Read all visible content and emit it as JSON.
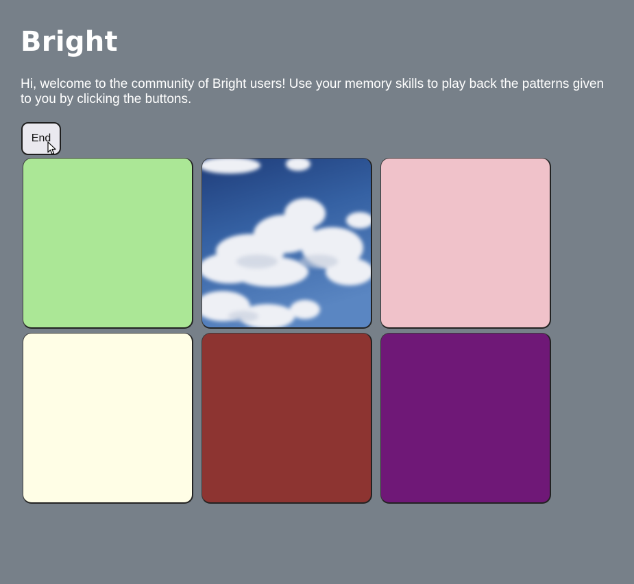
{
  "app": {
    "title": "Bright",
    "intro": "Hi, welcome to the community of Bright users! Use your memory skills to play back the patterns given to you by clicking the buttons."
  },
  "controls": {
    "end_label": "End"
  },
  "pads": [
    {
      "name": "green",
      "color": "#abe796"
    },
    {
      "name": "sky-clouds",
      "color": "#3f6aa8",
      "image": "clouds"
    },
    {
      "name": "pink",
      "color": "#f0c2ca"
    },
    {
      "name": "ivory",
      "color": "#fffee6"
    },
    {
      "name": "brown-red",
      "color": "#8d3431"
    },
    {
      "name": "purple",
      "color": "#6f1877"
    }
  ],
  "colors": {
    "background": "#778089",
    "text": "#ffffff",
    "button_bg": "#eae9ef"
  }
}
